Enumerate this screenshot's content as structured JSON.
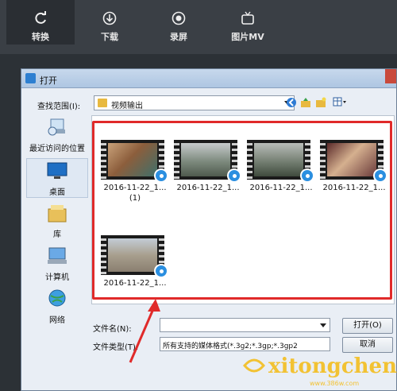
{
  "app_tabs": [
    {
      "label": "转换",
      "icon": "refresh-icon"
    },
    {
      "label": "下载",
      "icon": "download-icon"
    },
    {
      "label": "录屏",
      "icon": "record-icon"
    },
    {
      "label": "图片MV",
      "icon": "tv-icon"
    }
  ],
  "dialog": {
    "title": "打开",
    "look_in_label": "查找范围(I):",
    "look_in_value": "视频输出",
    "places": [
      {
        "label": "最近访问的位置",
        "icon": "recent-places-icon"
      },
      {
        "label": "桌面",
        "icon": "desktop-icon"
      },
      {
        "label": "库",
        "icon": "libraries-icon"
      },
      {
        "label": "计算机",
        "icon": "computer-icon"
      },
      {
        "label": "网络",
        "icon": "network-icon"
      }
    ],
    "files": [
      {
        "name": "2016-11-22_1...",
        "sub": "(1)"
      },
      {
        "name": "2016-11-22_1...",
        "sub": ""
      },
      {
        "name": "2016-11-22_1...",
        "sub": ""
      },
      {
        "name": "2016-11-22_1...",
        "sub": ""
      },
      {
        "name": "2016-11-22_1...",
        "sub": ""
      }
    ],
    "file_name_label": "文件名(N):",
    "file_name_value": "",
    "file_type_label": "文件类型(T):",
    "file_type_value": "所有支持的媒体格式(*.3g2;*.3gp;*.3gp2",
    "open_button": "打开(O)",
    "cancel_button": "取消"
  },
  "watermark": {
    "text": "xitongcheng",
    "url": "www.386w.com"
  },
  "colors": {
    "highlight": "#e02a2a",
    "accent": "#2b8fe0"
  }
}
